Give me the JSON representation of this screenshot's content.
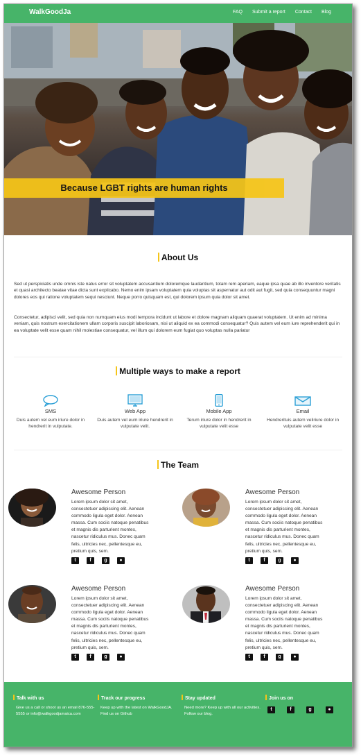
{
  "nav": {
    "brand": "WalkGoodJa",
    "links": [
      "FAQ",
      "Submit a report",
      "Contact",
      "Blog"
    ]
  },
  "hero": {
    "banner": "Because LGBT rights are human rights"
  },
  "about": {
    "title": "About Us",
    "p1": "Sed ut perspiciatis unde omnis iste natus error sit voluptatem accusantium doloremque laudantium, totam rem aperiam, eaque ipsa quae ab illo inventore veritatis et quasi architecto beatae vitae dicta sunt explicabo. Nemo enim ipsam voluptatem quia voluptas sit aspernatur aut odit aut fugit, sed quia consequuntur magni dolores eos qui ratione voluptatem sequi nesciunt. Neque porro quisquam est, qui dolorem ipsum quia dolor sit amet.",
    "p2": "Consectetur, adipisci velit, sed quia non numquam eius modi tempora incidunt ut labore et dolore magnam aliquam quaerat voluptatem. Ut enim ad minima veniam, quis nostrum exercitationem ullam corporis suscipit laboriosam, nisi ut aliquid ex ea commodi consequatur? Quis autem vel eum iure reprehenderit qui in ea voluptate velit esse quam nihil molestiae consequatur, vel illum qui dolorem eum fugiat quo voluptas nulla pariatur"
  },
  "report": {
    "title": "Multiple ways to make a report",
    "items": [
      {
        "icon": "chat-bubble-icon",
        "title": "SMS",
        "desc": "Duis autem vel eum iriure dolor in hendrerit in vulputate."
      },
      {
        "icon": "monitor-icon",
        "title": "Web App",
        "desc": "Duis autem vel eum iriure hendrerit in vulputate velit."
      },
      {
        "icon": "mobile-phone-icon",
        "title": "Mobile App",
        "desc": "Terum iriure dolor in hendrerit in vulputate velit esse"
      },
      {
        "icon": "envelope-icon",
        "title": "Email",
        "desc": "Hendrerituis autem veliriure dolor in vulputate velit esse"
      }
    ]
  },
  "team": {
    "title": "The Team",
    "members": [
      {
        "name": "Awesome Person",
        "bio": "Lorem ipsum dolor sit amet, consectetuer adipiscing elit. Aenean commodo ligula eget dolor. Aenean massa. Cum sociis natoque penatibus et magnis dis parturient montes, nascetur ridiculus mus. Donec quam felis, ultricies nec, pellentesque eu, pretium quis, sem."
      },
      {
        "name": "Awesome Person",
        "bio": "Lorem ipsum dolor sit amet, consectetuer adipiscing elit. Aenean commodo ligula eget dolor. Aenean massa. Cum sociis natoque penatibus et magnis dis parturient montes, nascetur ridiculus mus. Donec quam felis, ultricies nec, pellentesque eu, pretium quis, sem."
      },
      {
        "name": "Awesome Person",
        "bio": "Lorem ipsum dolor sit amet, consectetuer adipiscing elit. Aenean commodo ligula eget dolor. Aenean massa. Cum sociis natoque penatibus et magnis dis parturient montes, nascetur ridiculus mus. Donec quam felis, ultricies nec, pellentesque eu, pretium quis, sem."
      },
      {
        "name": "Awesome Person",
        "bio": "Lorem ipsum dolor sit amet, consectetuer adipiscing elit. Aenean commodo ligula eget dolor. Aenean massa. Cum sociis natoque penatibus et magnis dis parturient montes, nascetur ridiculus mus. Donec quam felis, ultricies nec, pellentesque eu, pretium quis, sem."
      }
    ],
    "social_icons": [
      "twitter-icon",
      "facebook-icon",
      "google-plus-icon",
      "flickr-icon"
    ]
  },
  "footer": {
    "talk": {
      "title": "Talk with us",
      "text": "Give us a call or shoot us an email 876-555-5555 or info@walkgoodjamaica.com"
    },
    "track": {
      "title": "Track our progress",
      "text": "Keep up with the latest on WalkGoodJA. Find us on Github"
    },
    "updated": {
      "title": "Stay updated",
      "text": "Need more? Keep up with all our activities. Follow our blog."
    },
    "join": {
      "title": "Join us on"
    }
  },
  "colors": {
    "brand_green": "#47b469",
    "accent_yellow": "#f5c518"
  }
}
